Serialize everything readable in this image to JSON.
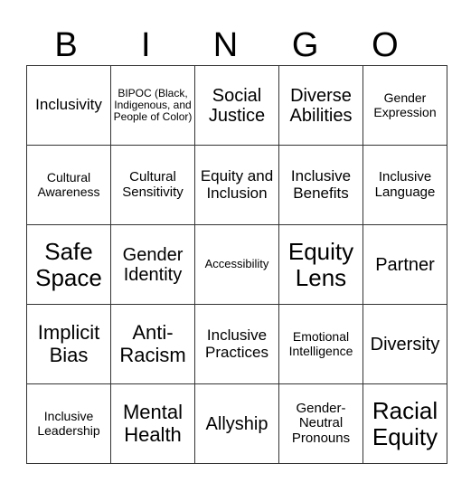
{
  "header": {
    "letters": [
      "B",
      "I",
      "N",
      "G",
      "O"
    ]
  },
  "cells": [
    [
      "Inclusivity",
      "BIPOC (Black, Indigenous, and People of Color)",
      "Social Justice",
      "Diverse Abilities",
      "Gender Expression"
    ],
    [
      "Cultural Awareness",
      "Cultural Sensitivity",
      "Equity and Inclusion",
      "Inclusive Benefits",
      "Inclusive Language"
    ],
    [
      "Safe Space",
      "Gender Identity",
      "Accessibility",
      "Equity Lens",
      "Partner"
    ],
    [
      "Implicit Bias",
      "Anti-Racism",
      "Inclusive Practices",
      "Emotional Intelligence",
      "Diversity"
    ],
    [
      "Inclusive Leadership",
      "Mental Health",
      "Allyship",
      "Gender-Neutral Pronouns",
      "Racial Equity"
    ]
  ]
}
